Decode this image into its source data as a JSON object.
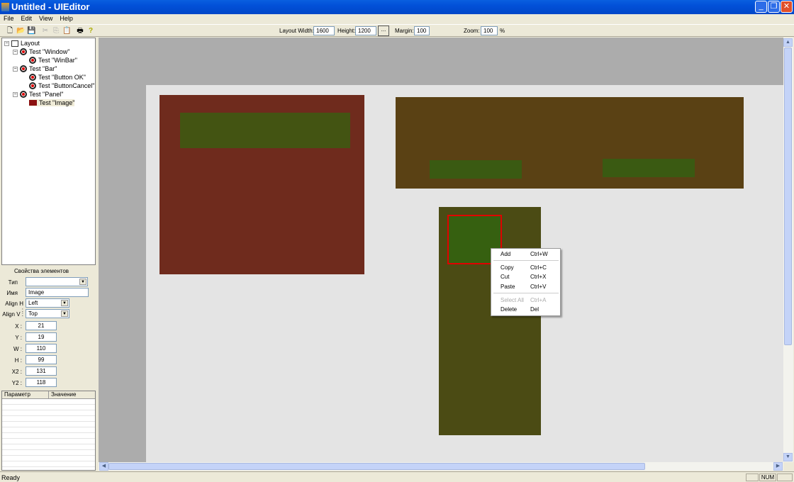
{
  "window": {
    "title": "Untitled - UIEditor",
    "minimize": "_",
    "restore": "❐",
    "close": "✕"
  },
  "menu": [
    "File",
    "Edit",
    "View",
    "Help"
  ],
  "toolbar": {
    "layout_width_label": "Layout Width:",
    "layout_width": "1600",
    "height_label": "Height:",
    "height": "1200",
    "browse": "...",
    "margin_label": "Margin:",
    "margin": "100",
    "zoom_label": "Zoom:",
    "zoom": "100",
    "zoom_unit": "%"
  },
  "tree": {
    "root": "Layout",
    "nodes": [
      "Test \"Window\"",
      "Test \"WinBar\"",
      "Test \"Bar\"",
      "Test \"Button OK\"",
      "Test \"ButtonCancel\"",
      "Test \"Panel\"",
      "Test \"Image\""
    ]
  },
  "props": {
    "title": "Свойства элементов",
    "type_label": "Тип",
    "type": "",
    "name_label": "Имя",
    "name": "Image",
    "align_h_label": "Align H :",
    "align_h": "Left",
    "align_v_label": "Align V :",
    "align_v": "Top",
    "x_label": "X :",
    "x": "21",
    "y_label": "Y :",
    "y": "19",
    "w_label": "W :",
    "w": "110",
    "h_label": "H :",
    "h": "99",
    "x2_label": "X2 :",
    "x2": "131",
    "y2_label": "Y2 :",
    "y2": "118"
  },
  "grid": {
    "col1": "Параметр",
    "col2": "Значение"
  },
  "context_menu": {
    "items": [
      {
        "label": "Add",
        "shortcut": "Ctrl+W",
        "enabled": true
      },
      {
        "label": "Copy",
        "shortcut": "Ctrl+C",
        "enabled": true
      },
      {
        "label": "Cut",
        "shortcut": "Ctrl+X",
        "enabled": true
      },
      {
        "label": "Paste",
        "shortcut": "Ctrl+V",
        "enabled": true
      },
      {
        "label": "Select All",
        "shortcut": "Ctrl+A",
        "enabled": false
      },
      {
        "label": "Delete",
        "shortcut": "Del",
        "enabled": true
      }
    ]
  },
  "colors": {
    "window": "#6f2b1d",
    "winbar": "#435412",
    "bar": "#5a4114",
    "button": "#3a5a12",
    "panel": "#4b4b14",
    "image": "#366010",
    "selection": "#e00000"
  },
  "status": {
    "text": "Ready",
    "num": "NUM"
  }
}
